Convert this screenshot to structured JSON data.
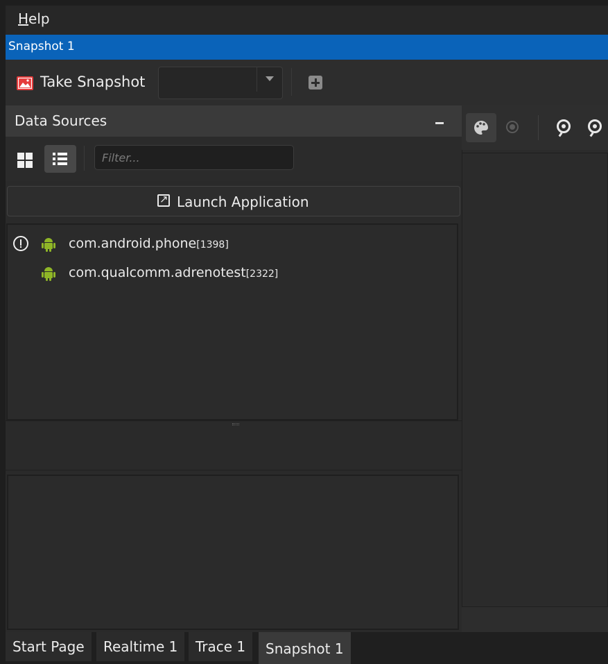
{
  "menu": {
    "help_label": "Help",
    "help_mnemonic": "H",
    "help_rest": "elp"
  },
  "title": "Snapshot 1",
  "toolbar": {
    "take_snapshot_label": "Take Snapshot",
    "snapshot_icon": "image-icon",
    "snapshot_icon_color": "#e53b3b",
    "combo_value": "",
    "add_icon": "plus-square-icon"
  },
  "data_sources": {
    "title": "Data Sources",
    "collapse_label": "–",
    "filter_placeholder": "Filter...",
    "launch_label": "Launch Application",
    "processes": [
      {
        "name": "com.android.phone",
        "pid": "[1398]",
        "warning": true
      },
      {
        "name": "com.qualcomm.adrenotest",
        "pid": "[2322]",
        "warning": false
      }
    ],
    "android_icon_color": "#8fb627"
  },
  "tabs": [
    {
      "label": "Start Page",
      "active": false
    },
    {
      "label": "Realtime 1",
      "active": false
    },
    {
      "label": "Trace 1",
      "active": false
    },
    {
      "label": "Snapshot 1",
      "active": true
    }
  ],
  "colors": {
    "title_bar": "#0a63b9",
    "background": "#2b2b2b"
  }
}
